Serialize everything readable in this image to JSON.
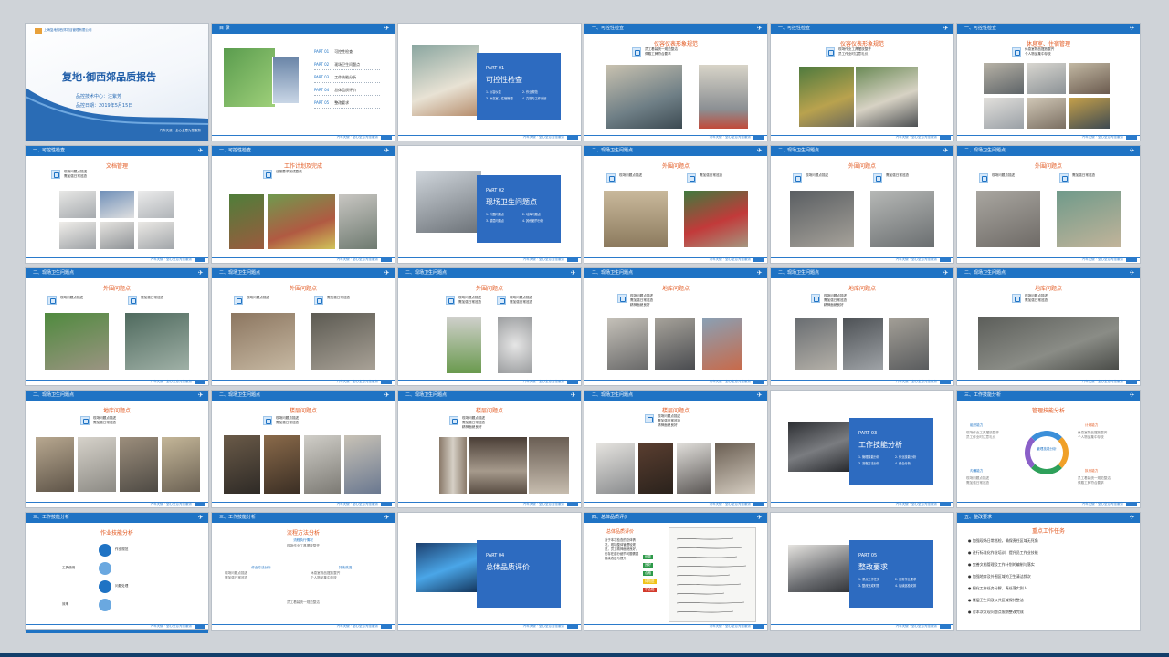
{
  "cover": {
    "company": "上海复地御西郊项目管理有限公司",
    "title": "复地·御西郊品质报告",
    "line1": "品控技术中心：汪紫芳",
    "line2": "品控日期：2019年5月15日",
    "footer": "汽车天使 · 全心全意为您服务"
  },
  "toc": {
    "header": "目 录",
    "items": [
      {
        "num": "PART 01",
        "label": "可控性检查"
      },
      {
        "num": "PART 02",
        "label": "现场卫生问题点"
      },
      {
        "num": "PART 03",
        "label": "工作技能分析"
      },
      {
        "num": "PART 04",
        "label": "总体品质评价"
      },
      {
        "num": "PART 05",
        "label": "整改要求"
      }
    ]
  },
  "footer_note": "汽车天使 · 全心全意为您服务",
  "headers": {
    "h1": "一、可控性检查",
    "h2": "二、现场卫生问题点",
    "h3": "三、工作技能分析",
    "h4": "四、总体品质评价",
    "h5": "五、整改要求"
  },
  "parts": [
    {
      "num": "PART 01",
      "title": "可控性检查",
      "items": [
        "1. 仪容仪表",
        "2. 作业规范",
        "3. 休息室、住宿管理",
        "4. 文档与工作计划"
      ]
    },
    {
      "num": "PART 02",
      "title": "现场卫生问题点",
      "items": [
        "1. 外围问题点",
        "2. 地库问题点",
        "3. 楼层问题点",
        "4. 其他细节分析"
      ]
    },
    {
      "num": "PART 03",
      "title": "工作技能分析",
      "items": [
        "1. 管理技能分析",
        "2. 作业技能分析",
        "3. 流程方法分析",
        "4. 综合分析"
      ]
    },
    {
      "num": "PART 04",
      "title": "总体品质评价",
      "items": []
    },
    {
      "num": "PART 05",
      "title": "整改要求",
      "items": [
        "1. 重点工作任务",
        "2. 日常作业要求",
        "3. 整改完成时限",
        "4. 后续巡检安排"
      ]
    }
  ],
  "slide_titles": {
    "uniform": "仪容仪表形象规范",
    "uniform2": "仪容仪表形象规范",
    "rest": "休息室、住宿管理",
    "doc": "文档管理",
    "plan": "工作计划及完成",
    "outer": "外围问题点",
    "garage": "地库问题点",
    "floor": "楼层问题点",
    "mgmt": "管理技能分析",
    "work": "作业技能分析",
    "flow": "流程方法分析",
    "overall": "总体品质评价",
    "key": "重点工作任务"
  },
  "bullets": {
    "b1": [
      "员工着装统一规范整洁",
      "佩戴工牌符合要求",
      "精神面貌良好"
    ],
    "b2": [
      "现场作业工具摆放整齐",
      "员工作业时注意礼仪"
    ],
    "b3": [
      "休息室物品摆放整齐",
      "个人物品集中存放"
    ],
    "b4": [
      "现场问题点描述",
      "需加强日常巡查"
    ],
    "b5": [
      "已按要求完成整改"
    ],
    "key": [
      "加强现场日常巡检，确保责任区域无死角",
      "进行标准化作业培训，提升员工作业技能",
      "完善文档管理及工作计划的编制与落实",
      "加强地库及外围区域的卫生清洁频次",
      "细化工作任务分解，责任落实到人",
      "楼层卫生间及公共区域保持整洁",
      "对本次发现问题点限期整改完成"
    ]
  },
  "mgmt": {
    "center": "管理技能分析",
    "labels": [
      "组织能力",
      "计划能力",
      "沟通能力",
      "执行能力"
    ]
  },
  "work": {
    "labels": [
      "作业规范",
      "工具使用",
      "问题处理",
      "效率"
    ]
  },
  "flow": {
    "box1": "流程执行情况",
    "box2": "作业方法分析",
    "box3": "持续改进"
  },
  "overall": {
    "text": "对于本次检查的总体情况，现场整体管理较规范，员工精神面貌良好，仍存在部分细节问题需要持续改进与提升。",
    "tags": [
      "优秀",
      "良好",
      "合格",
      "待改进",
      "不合格"
    ],
    "tag_colors": [
      "#2e9a4a",
      "#2e9a4a",
      "#2e9a4a",
      "#f0c419",
      "#d33a2c"
    ]
  },
  "colors": {
    "accent": "#1f73c4",
    "title": "#e2571e",
    "panel": "#2d6bc0"
  }
}
